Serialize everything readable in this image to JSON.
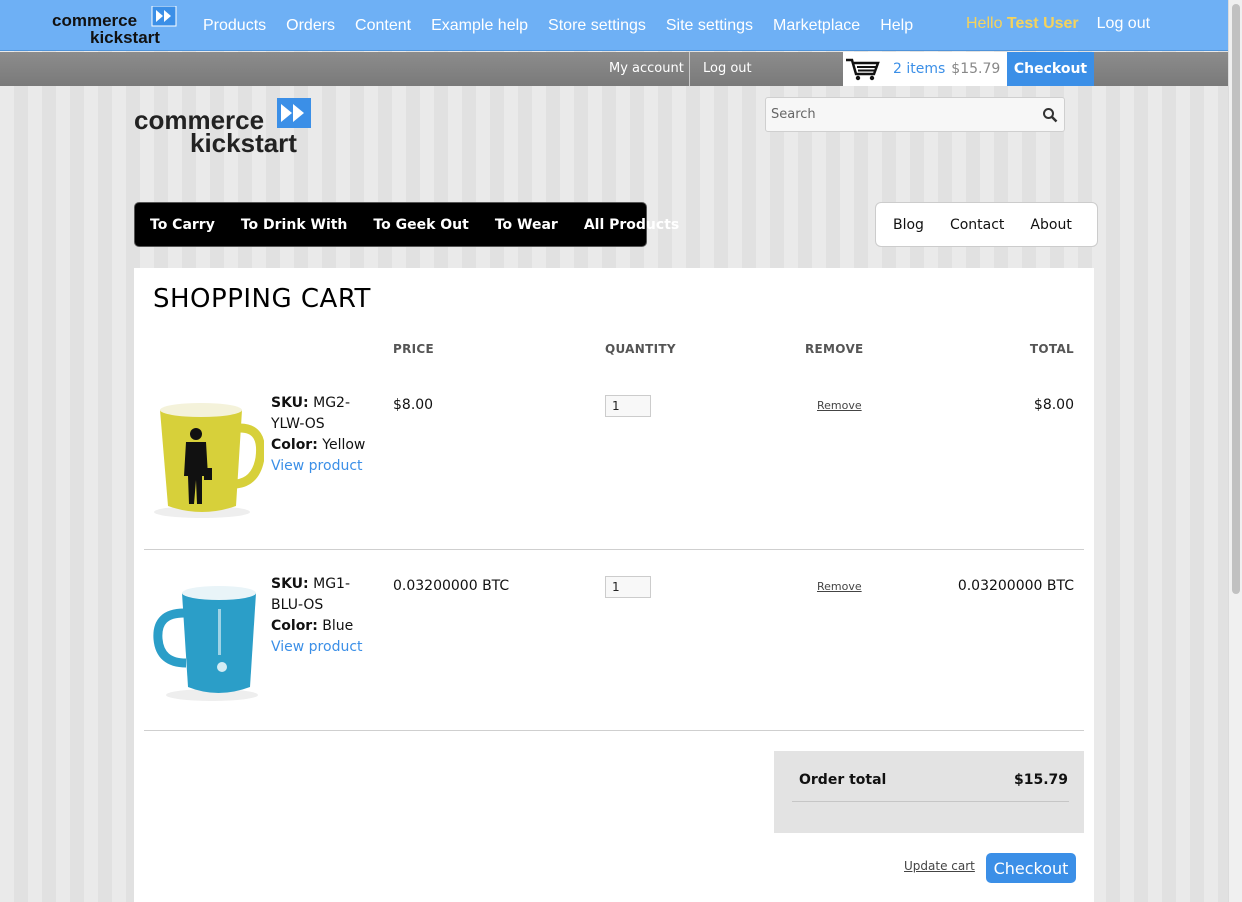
{
  "admin_bar": {
    "logo_text_1": "commerce",
    "logo_text_2": "kickstart",
    "nav": [
      "Products",
      "Orders",
      "Content",
      "Example help",
      "Store settings",
      "Site settings",
      "Marketplace",
      "Help"
    ],
    "hello_prefix": "Hello",
    "user_name": "Test User",
    "logout": "Log out"
  },
  "user_bar": {
    "my_account": "My account",
    "logout": "Log out",
    "cart_count": "2 items",
    "cart_price": "$15.79",
    "checkout": "Checkout"
  },
  "site": {
    "logo_text_1": "commerce",
    "logo_text_2": "kickstart",
    "search_placeholder": "Search"
  },
  "main_menu": [
    "To Carry",
    "To Drink With",
    "To Geek Out",
    "To Wear",
    "All Products"
  ],
  "side_menu": [
    "Blog",
    "Contact",
    "About"
  ],
  "cart": {
    "title": "SHOPPING CART",
    "headers": {
      "price": "PRICE",
      "quantity": "QUANTITY",
      "remove": "REMOVE",
      "total": "TOTAL"
    },
    "items": [
      {
        "sku_label": "SKU:",
        "sku": "MG2-YLW-OS",
        "color_label": "Color:",
        "color": "Yellow",
        "view_link": "View product",
        "price": "$8.00",
        "quantity": "1",
        "remove": "Remove",
        "total": "$8.00",
        "mug_color": "#d7d03a"
      },
      {
        "sku_label": "SKU:",
        "sku": "MG1-BLU-OS",
        "color_label": "Color:",
        "color": "Blue",
        "view_link": "View product",
        "price": "0.03200000 BTC",
        "quantity": "1",
        "remove": "Remove",
        "total": "0.03200000 BTC",
        "mug_color": "#2b9ec8"
      }
    ],
    "order_total_label": "Order total",
    "order_total_value": "$15.79",
    "update_cart": "Update cart",
    "checkout": "Checkout"
  },
  "colors": {
    "admin_bar": "#6eb0f5",
    "accent": "#3b8fe7",
    "hello": "#f6d35b"
  }
}
